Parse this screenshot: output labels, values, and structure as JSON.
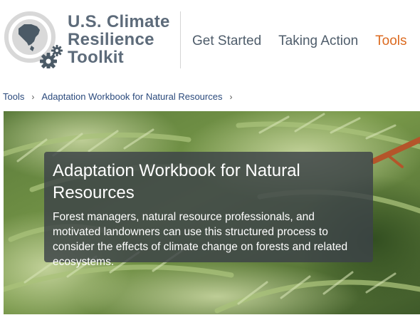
{
  "logo": {
    "line1": "U.S. Climate",
    "line2": "Resilience",
    "line3": "Toolkit",
    "icon": "north-america-gear-icon"
  },
  "nav": {
    "items": [
      {
        "label": "Get Started",
        "active": false
      },
      {
        "label": "Taking Action",
        "active": false
      },
      {
        "label": "Tools",
        "active": true
      }
    ]
  },
  "breadcrumb": {
    "items": [
      "Tools",
      "Adaptation Workbook for Natural Resources"
    ],
    "separator": "›"
  },
  "hero": {
    "title": "Adaptation Workbook for Natural Resources",
    "description": "Forest managers, natural resource professionals, and motivated landowners can use this structured process to consider the effects of climate change on forests and related ecosystems."
  },
  "colors": {
    "accent": "#dc6a1f",
    "nav_text": "#4f5d6b",
    "link": "#2b4a7c",
    "hero_overlay": "#3c4248"
  }
}
